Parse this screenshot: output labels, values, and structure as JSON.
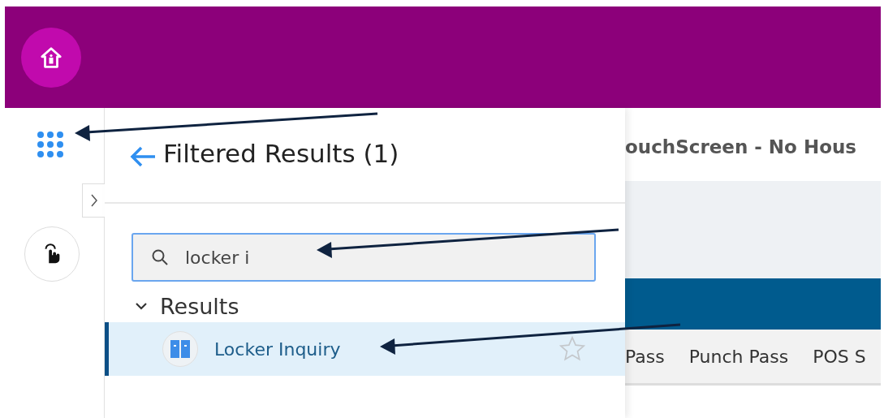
{
  "panel": {
    "title": "Filtered Results (1)",
    "search": {
      "value": "locker i"
    },
    "section": {
      "label": "Results",
      "expanded": true
    },
    "results": [
      {
        "label": "Locker Inquiry",
        "selected": true,
        "favorite": false
      }
    ]
  },
  "background_page": {
    "title": "ouchScreen - No Hous",
    "tabs": [
      "Pass",
      "Punch Pass",
      "POS S"
    ]
  },
  "annotations": [
    {
      "kind": "arrow"
    },
    {
      "kind": "arrow"
    },
    {
      "kind": "arrow"
    }
  ]
}
